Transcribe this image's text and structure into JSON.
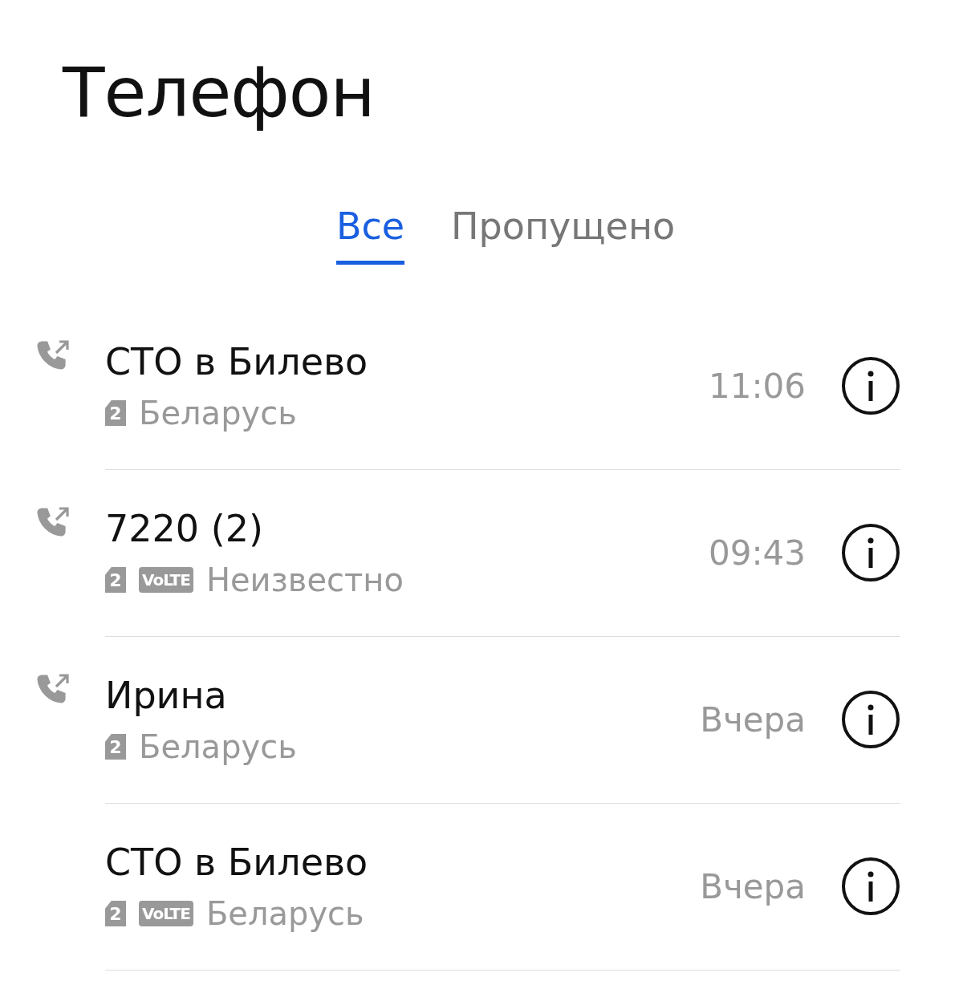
{
  "title": "Телефон",
  "tabs": [
    {
      "label": "Все",
      "selected": true
    },
    {
      "label": "Пропущено",
      "selected": false
    }
  ],
  "calls": [
    {
      "name": "СТО в Билево",
      "outgoing": true,
      "sim": "2",
      "subtitle": "Беларусь",
      "time": "11:06"
    },
    {
      "name": "7220 (2)",
      "outgoing": true,
      "sim": "2",
      "volte": "VoLTE",
      "subtitle": "Неизвестно",
      "time": "09:43"
    },
    {
      "name": "Ирина",
      "outgoing": true,
      "sim": "2",
      "subtitle": "Беларусь",
      "time": "Вчера"
    },
    {
      "name": "СТО в Билево",
      "outgoing": false,
      "sim": "2",
      "volte": "VoLTE",
      "subtitle": "Беларусь",
      "time": "Вчера"
    }
  ]
}
